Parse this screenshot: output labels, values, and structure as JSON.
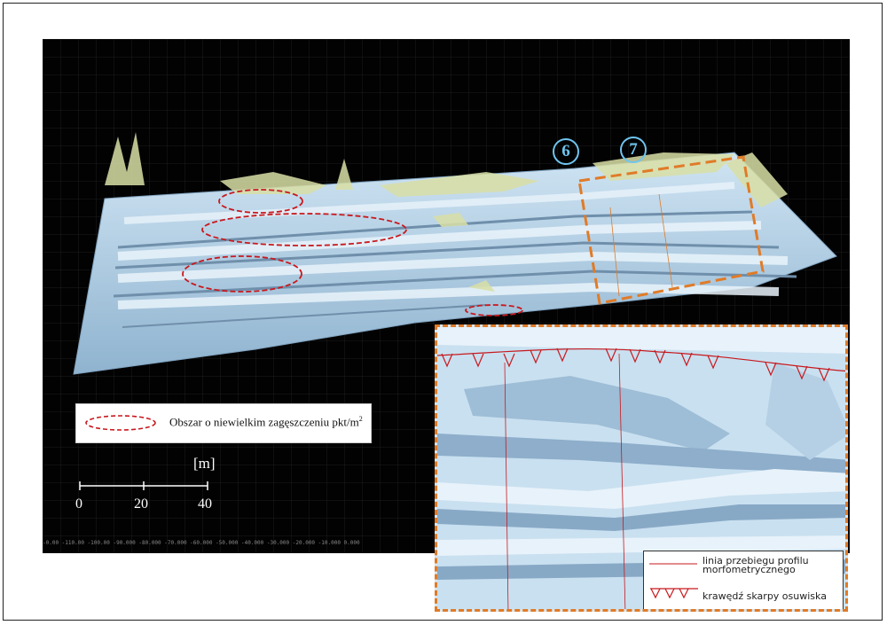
{
  "map": {
    "markers": [
      "6",
      "7"
    ],
    "axis_ticks": "-0.00  -110.00  -100.00  -90.000  -80.000  -70.000  -60.000  -50.000  -40.000  -30.000  -20.000  -10.000  0.000"
  },
  "legend": {
    "low_density_label": "Obszar o niewielkim zagęszczeniu pkt/m",
    "low_density_sup": "2"
  },
  "scale": {
    "unit": "[m]",
    "labels": [
      "0",
      "20",
      "40"
    ]
  },
  "inset": {
    "profile_line_label_1": "linia przebiegu profilu",
    "profile_line_label_2": "morfometrycznego",
    "scarp_edge_label": "krawędź skarpy osuwiska"
  },
  "colors": {
    "background": "#020202",
    "terrain": "#b8d6ec",
    "vegetation": "#d9dfa6",
    "ellipse": "#c8191e",
    "inset_border": "#e07b28",
    "marker": "#6fc4ef",
    "scarp": "#c8191e"
  }
}
